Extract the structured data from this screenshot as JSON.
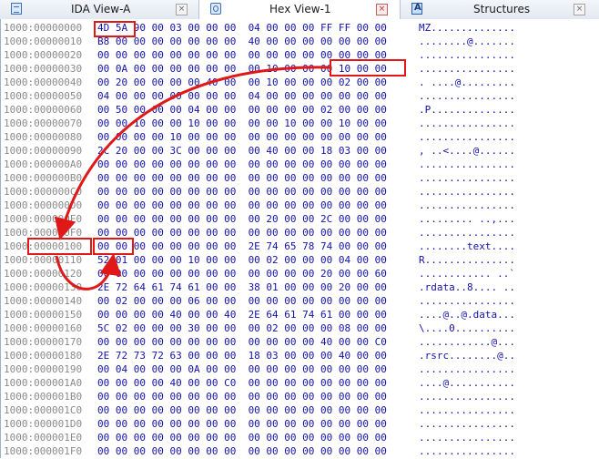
{
  "tabs": [
    {
      "label": "IDA View-A",
      "close": "×",
      "active": false,
      "icon": "ida-view-icon"
    },
    {
      "label": "Hex View-1",
      "close": "×",
      "active": true,
      "icon": "hex-view-icon"
    },
    {
      "label": "Structures",
      "close": "×",
      "active": false,
      "icon": "structures-icon"
    }
  ],
  "colors": {
    "address": "#8a8a8a",
    "hex_bytes": "#1212a8",
    "highlight": "#e01818"
  },
  "hex_rows": [
    {
      "addr": "1000:00000000",
      "hex": "4D 5A 90 00 03 00 00 00  04 00 00 00 FF FF 00 00",
      "ascii": "MZ.............."
    },
    {
      "addr": "1000:00000010",
      "hex": "B8 00 00 00 00 00 00 00  40 00 00 00 00 00 00 00",
      "ascii": "........@......."
    },
    {
      "addr": "1000:00000020",
      "hex": "00 00 00 00 00 00 00 00  00 00 00 00 00 00 00 00",
      "ascii": "................"
    },
    {
      "addr": "1000:00000030",
      "hex": "00 0A 00 00 00 00 00 00  00 10 00 00 00 10 00 00",
      "ascii": "................"
    },
    {
      "addr": "1000:00000040",
      "hex": "00 20 00 00 00 00 40 00  00 10 00 00 00 02 00 00",
      "ascii": ". ....@........."
    },
    {
      "addr": "1000:00000050",
      "hex": "04 00 00 00 00 00 00 00  04 00 00 00 00 00 00 00",
      "ascii": "................"
    },
    {
      "addr": "1000:00000060",
      "hex": "00 50 00 00 00 04 00 00  00 00 00 00 02 00 00 00",
      "ascii": ".P.............."
    },
    {
      "addr": "1000:00000070",
      "hex": "00 00 10 00 00 10 00 00  00 00 10 00 00 10 00 00",
      "ascii": "................"
    },
    {
      "addr": "1000:00000080",
      "hex": "00 00 00 00 10 00 00 00  00 00 00 00 00 00 00 00",
      "ascii": "................"
    },
    {
      "addr": "1000:00000090",
      "hex": "2C 20 00 00 3C 00 00 00  00 40 00 00 18 03 00 00",
      "ascii": ", ..<....@......"
    },
    {
      "addr": "1000:000000A0",
      "hex": "00 00 00 00 00 00 00 00  00 00 00 00 00 00 00 00",
      "ascii": "................"
    },
    {
      "addr": "1000:000000B0",
      "hex": "00 00 00 00 00 00 00 00  00 00 00 00 00 00 00 00",
      "ascii": "................"
    },
    {
      "addr": "1000:000000C0",
      "hex": "00 00 00 00 00 00 00 00  00 00 00 00 00 00 00 00",
      "ascii": "................"
    },
    {
      "addr": "1000:000000D0",
      "hex": "00 00 00 00 00 00 00 00  00 00 00 00 00 00 00 00",
      "ascii": "................"
    },
    {
      "addr": "1000:000000E0",
      "hex": "00 00 00 00 00 00 00 00  00 20 00 00 2C 00 00 00",
      "ascii": "......... ..,..."
    },
    {
      "addr": "1000:000000F0",
      "hex": "00 00 00 00 00 00 00 00  00 00 00 00 00 00 00 00",
      "ascii": "................"
    },
    {
      "addr": "1000:00000100",
      "hex": "00 00 00 00 00 00 00 00  2E 74 65 78 74 00 00 00",
      "ascii": "........text...."
    },
    {
      "addr": "1000:00000110",
      "hex": "52 01 00 00 00 10 00 00  00 02 00 00 00 04 00 00",
      "ascii": "R..............."
    },
    {
      "addr": "1000:00000120",
      "hex": "00 00 00 00 00 00 00 00  00 00 00 00 20 00 00 60",
      "ascii": "............ ..`"
    },
    {
      "addr": "1000:00000130",
      "hex": "2E 72 64 61 74 61 00 00  38 01 00 00 00 20 00 00",
      "ascii": ".rdata..8.... .."
    },
    {
      "addr": "1000:00000140",
      "hex": "00 02 00 00 00 06 00 00  00 00 00 00 00 00 00 00",
      "ascii": "................"
    },
    {
      "addr": "1000:00000150",
      "hex": "00 00 00 00 40 00 00 40  2E 64 61 74 61 00 00 00",
      "ascii": "....@..@.data..."
    },
    {
      "addr": "1000:00000160",
      "hex": "5C 02 00 00 00 30 00 00  00 02 00 00 00 08 00 00",
      "ascii": "\\....0.........."
    },
    {
      "addr": "1000:00000170",
      "hex": "00 00 00 00 00 00 00 00  00 00 00 00 40 00 00 C0",
      "ascii": "............@..."
    },
    {
      "addr": "1000:00000180",
      "hex": "2E 72 73 72 63 00 00 00  18 03 00 00 00 40 00 00",
      "ascii": ".rsrc........@.."
    },
    {
      "addr": "1000:00000190",
      "hex": "00 04 00 00 00 0A 00 00  00 00 00 00 00 00 00 00",
      "ascii": "................"
    },
    {
      "addr": "1000:000001A0",
      "hex": "00 00 00 00 40 00 00 C0  00 00 00 00 00 00 00 00",
      "ascii": "....@..........."
    },
    {
      "addr": "1000:000001B0",
      "hex": "00 00 00 00 00 00 00 00  00 00 00 00 00 00 00 00",
      "ascii": "................"
    },
    {
      "addr": "1000:000001C0",
      "hex": "00 00 00 00 00 00 00 00  00 00 00 00 00 00 00 00",
      "ascii": "................"
    },
    {
      "addr": "1000:000001D0",
      "hex": "00 00 00 00 00 00 00 00  00 00 00 00 00 00 00 00",
      "ascii": "................"
    },
    {
      "addr": "1000:000001E0",
      "hex": "00 00 00 00 00 00 00 00  00 00 00 00 00 00 00 00",
      "ascii": "................"
    },
    {
      "addr": "1000:000001F0",
      "hex": "00 00 00 00 00 00 00 00  00 00 00 00 00 00 00 00",
      "ascii": "................"
    }
  ]
}
